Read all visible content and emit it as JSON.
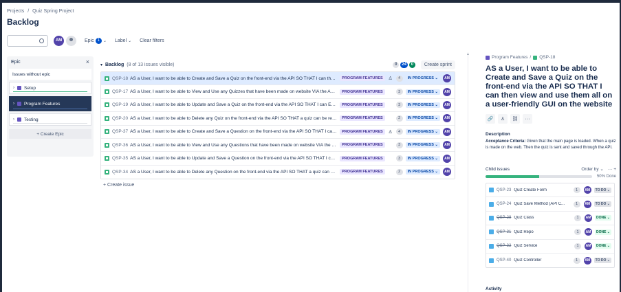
{
  "breadcrumb": {
    "projects": "Projects",
    "separator": "/",
    "project": "Quiz Spring Project"
  },
  "page_title": "Backlog",
  "filters": {
    "search_placeholder": "",
    "avatar_initials": "AM",
    "epic_label": "Epic",
    "epic_count": "1",
    "label_label": "Label",
    "clear_label": "Clear filters"
  },
  "epic_panel": {
    "title": "Epic",
    "close_icon": "×",
    "no_epic_label": "Issues without epic",
    "epics": [
      {
        "name": "Setup",
        "color": "#6554c0",
        "progress": 1.0,
        "selected": false
      },
      {
        "name": "Program Features",
        "color": "#6554c0",
        "progress": 0.0,
        "selected": true
      },
      {
        "name": "Testing",
        "color": "#6554c0",
        "progress": 0.0,
        "selected": false
      }
    ],
    "create_label": "+ Create Epic"
  },
  "backlog": {
    "title": "Backlog",
    "visible_text": "(8 of 13 issues visible)",
    "count_todo": "0",
    "count_progress": "24",
    "count_done": "0",
    "create_sprint_label": "Create sprint",
    "issues": [
      {
        "key": "QSP-18",
        "summary": "AS a User, I want to be able to Create and Save a Quiz on the front-end via the API SO THAT I can then view and use them all on a user-friendly GUI on the website",
        "epic": "PROGRAM FEATURES",
        "tree": "♙",
        "points": "4",
        "status": "IN PROGRESS ⌄",
        "avatar": "AM"
      },
      {
        "key": "QSP-17",
        "summary": "AS a User, I want to be able to View and Use any Quizzes that have been made on website VIA the API SO THAT I can use them",
        "epic": "PROGRAM FEATURES",
        "tree": "",
        "points": "3",
        "status": "IN PROGRESS ⌄",
        "avatar": "AM"
      },
      {
        "key": "QSP-19",
        "summary": "AS a User, I want to be able to Update and Save a Quiz on the front-end via the API SO THAT I can Edit any Quiz",
        "epic": "PROGRAM FEATURES",
        "tree": "",
        "points": "3",
        "status": "IN PROGRESS ⌄",
        "avatar": "AM"
      },
      {
        "key": "QSP-20",
        "summary": "AS a User, I want to be able to Delete any Quiz on the front-end via the API SO THAT a quiz can be removed",
        "epic": "PROGRAM FEATURES",
        "tree": "",
        "points": "2",
        "status": "IN PROGRESS ⌄",
        "avatar": "AM"
      },
      {
        "key": "QSP-37",
        "summary": "AS a User, I want to be able to Create and Save a Question on the front-end via the API SO THAT I can then view them",
        "epic": "PROGRAM FEATURES",
        "tree": "♙",
        "points": "4",
        "status": "IN PROGRESS ⌄",
        "avatar": "AM"
      },
      {
        "key": "QSP-36",
        "summary": "AS a User, I want to be able to View and Use any Questions that have been made on website VIA the API SO THAT I can use them",
        "epic": "PROGRAM FEATURES",
        "tree": "",
        "points": "3",
        "status": "IN PROGRESS ⌄",
        "avatar": "AM"
      },
      {
        "key": "QSP-35",
        "summary": "AS a User, I want to be able to Update and Save a Question on the front-end via the API SO THAT I can Edit any Question",
        "epic": "PROGRAM FEATURES",
        "tree": "",
        "points": "3",
        "status": "IN PROGRESS ⌄",
        "avatar": "AM"
      },
      {
        "key": "QSP-34",
        "summary": "AS a User, I want to be able to Delete any Question on the front-end via the API SO THAT a quiz can be removed",
        "epic": "PROGRAM FEATURES",
        "tree": "",
        "points": "2",
        "status": "IN PROGRESS ⌄",
        "avatar": "AM"
      }
    ],
    "create_issue_label": "+ Create issue"
  },
  "detail": {
    "crumb_epic": "Program Features",
    "crumb_sep": "/",
    "crumb_key": "QSP-18",
    "title": "AS a User, I want to be able to Create and Save a Quiz on the front-end via the API SO THAT I can then view and use them all on a user-friendly GUI on the website",
    "actions": [
      "🔗",
      "♙",
      "⛓",
      "···"
    ],
    "description_label": "Description",
    "description_bold": "Acceptance Criteria:",
    "description_text": " Given that the main page is loaded. When a quiz is made on the web. Then the quiz is sent and saved through the API.",
    "child_issues_label": "Child issues",
    "order_by_label": "Order by ⌄",
    "more_label": "···  +",
    "progress": 0.5,
    "progress_label": "50% Done",
    "children": [
      {
        "key": "QSP-23",
        "summary": "Quiz Create Form",
        "points": "1",
        "avatar": "AM",
        "status": "TO DO ⌄",
        "done": false
      },
      {
        "key": "QSP-24",
        "summary": "Quiz Save Method (API C...",
        "points": "1",
        "avatar": "AM",
        "status": "TO DO ⌄",
        "done": false
      },
      {
        "key": "QSP-28",
        "summary": "Quiz Class",
        "points": "1",
        "avatar": "AM",
        "status": "DONE ⌄",
        "done": true
      },
      {
        "key": "QSP-31",
        "summary": "Quiz Repo",
        "points": "1",
        "avatar": "AM",
        "status": "DONE ⌄",
        "done": true
      },
      {
        "key": "QSP-32",
        "summary": "Quiz Service",
        "points": "1",
        "avatar": "AM",
        "status": "DONE ⌄",
        "done": true
      },
      {
        "key": "QSP-40",
        "summary": "Quiz Controller",
        "points": "1",
        "avatar": "AM",
        "status": "TO DO ⌄",
        "done": false
      }
    ],
    "activity_label": "Activity"
  }
}
